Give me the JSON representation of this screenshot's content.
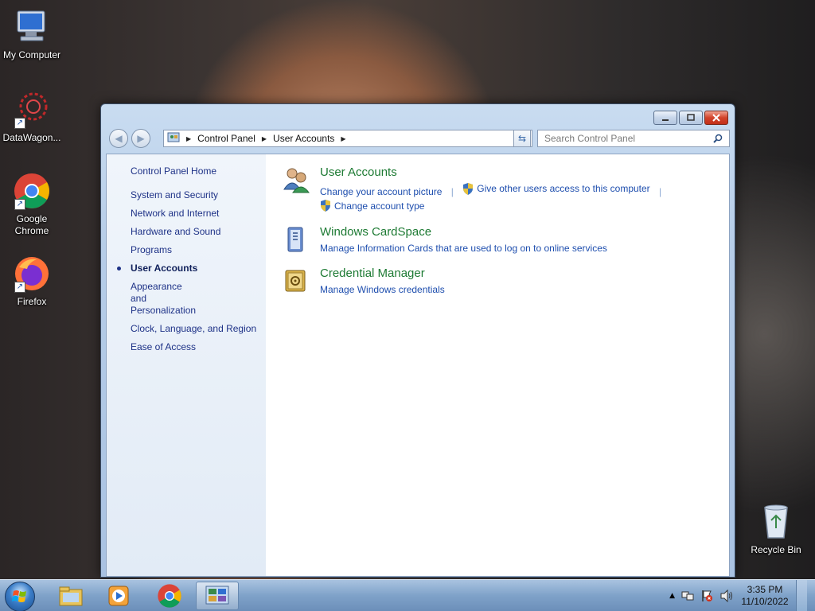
{
  "desktop": {
    "icons": [
      {
        "label": "My Computer",
        "icon": "computer-icon"
      },
      {
        "label": "DataWagon...",
        "icon": "datawagon-icon"
      },
      {
        "label": "Google Chrome",
        "icon": "chrome-icon"
      },
      {
        "label": "Firefox",
        "icon": "firefox-icon"
      },
      {
        "label": "Recycle Bin",
        "icon": "recycle-bin-icon"
      }
    ]
  },
  "window": {
    "title": "User Accounts",
    "buttons": {
      "minimize": "minimize-icon",
      "maximize": "maximize-icon",
      "close": "close-icon"
    },
    "breadcrumb": [
      "Control Panel",
      "User Accounts"
    ],
    "search_placeholder": "Search Control Panel",
    "left_nav": {
      "home": "Control Panel Home",
      "items": [
        {
          "label": "System and Security",
          "active": false
        },
        {
          "label": "Network and Internet",
          "active": false
        },
        {
          "label": "Hardware and Sound",
          "active": false
        },
        {
          "label": "Programs",
          "active": false
        },
        {
          "label": "User Accounts",
          "active": true
        },
        {
          "label": "Appearance and Personalization",
          "active": false
        },
        {
          "label": "Clock, Language, and Region",
          "active": false
        },
        {
          "label": "Ease of Access",
          "active": false
        }
      ]
    },
    "tasks": [
      {
        "title": "User Accounts",
        "links": [
          "Change your account picture",
          "Give other users access to this computer",
          "Change account type"
        ]
      },
      {
        "title": "Windows CardSpace",
        "links": [
          "Manage Information Cards that are used to log on to online services"
        ]
      },
      {
        "title": "Credential Manager",
        "links": [
          "Manage Windows credentials"
        ]
      }
    ]
  },
  "taskbar": {
    "items": [
      "start-orb-icon",
      "explorer-icon",
      "media-player-icon",
      "chrome-icon",
      "control-panel-icon"
    ],
    "tray": {
      "time": "3:35 PM",
      "date": "11/10/2022"
    }
  },
  "colors": {
    "link": "#1e4eae",
    "task_title": "#1d7a33",
    "taskbar": "#7fa2c9"
  }
}
